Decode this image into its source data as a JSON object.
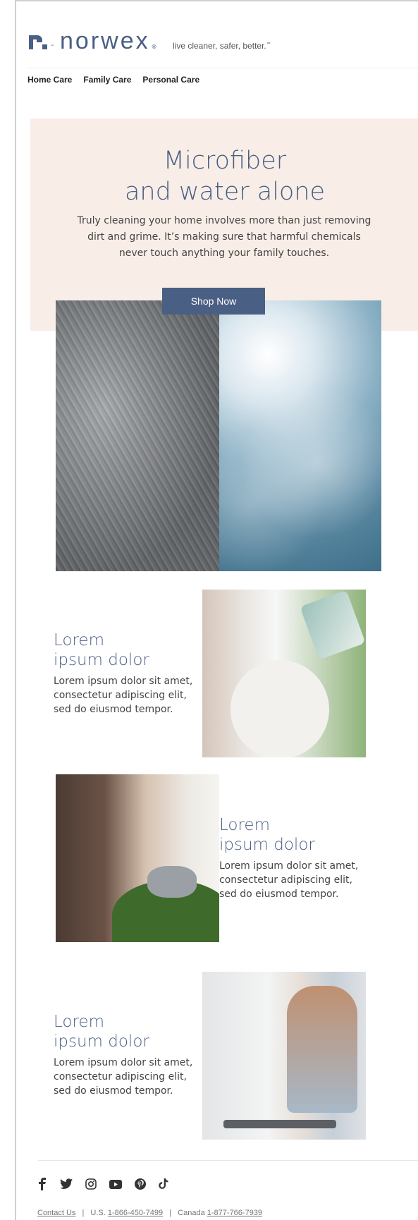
{
  "brand": {
    "name": "norwex",
    "tagline": "live cleaner, safer, better.",
    "tm": "™",
    "reg": "®",
    "brand_color": "#4a5f84",
    "hero_bg_color": "#f8eee7"
  },
  "nav": {
    "items": [
      {
        "label": "Home Care"
      },
      {
        "label": "Family Care"
      },
      {
        "label": "Personal Care"
      }
    ]
  },
  "hero": {
    "title_line1": "Microfiber",
    "title_line2": "and water alone",
    "subtitle": "Truly cleaning your home involves more than just removing dirt and grime. It’s making sure that harmful chemicals never touch anything your family touches.",
    "button_label": "Shop Now"
  },
  "features": [
    {
      "title_line1": "Lorem",
      "title_line2": "ipsum dolor",
      "body": "Lorem ipsum dolor sit amet, consectetur adipiscing elit, sed do eiusmod tempor."
    },
    {
      "title_line1": "Lorem",
      "title_line2": "ipsum dolor",
      "body": "Lorem ipsum dolor sit amet, consectetur adipiscing elit, sed do eiusmod tempor."
    },
    {
      "title_line1": "Lorem",
      "title_line2": "ipsum dolor",
      "body": "Lorem ipsum dolor sit amet, consectetur adipiscing elit, sed do eiusmod tempor."
    }
  ],
  "social": {
    "icons": [
      {
        "name": "facebook-icon",
        "glyph": "f"
      },
      {
        "name": "twitter-icon",
        "glyph": "🐦"
      },
      {
        "name": "instagram-icon",
        "glyph": "◎"
      },
      {
        "name": "youtube-icon",
        "glyph": "▶"
      },
      {
        "name": "pinterest-icon",
        "glyph": "℗"
      },
      {
        "name": "tiktok-icon",
        "glyph": "♪"
      }
    ]
  },
  "footer": {
    "contact_label": "Contact Us",
    "us_prefix": "U.S.",
    "us_phone": "1-866-450-7499",
    "canada_prefix": "Canada",
    "canada_phone": "1-877-766-7939",
    "separator": "|"
  }
}
